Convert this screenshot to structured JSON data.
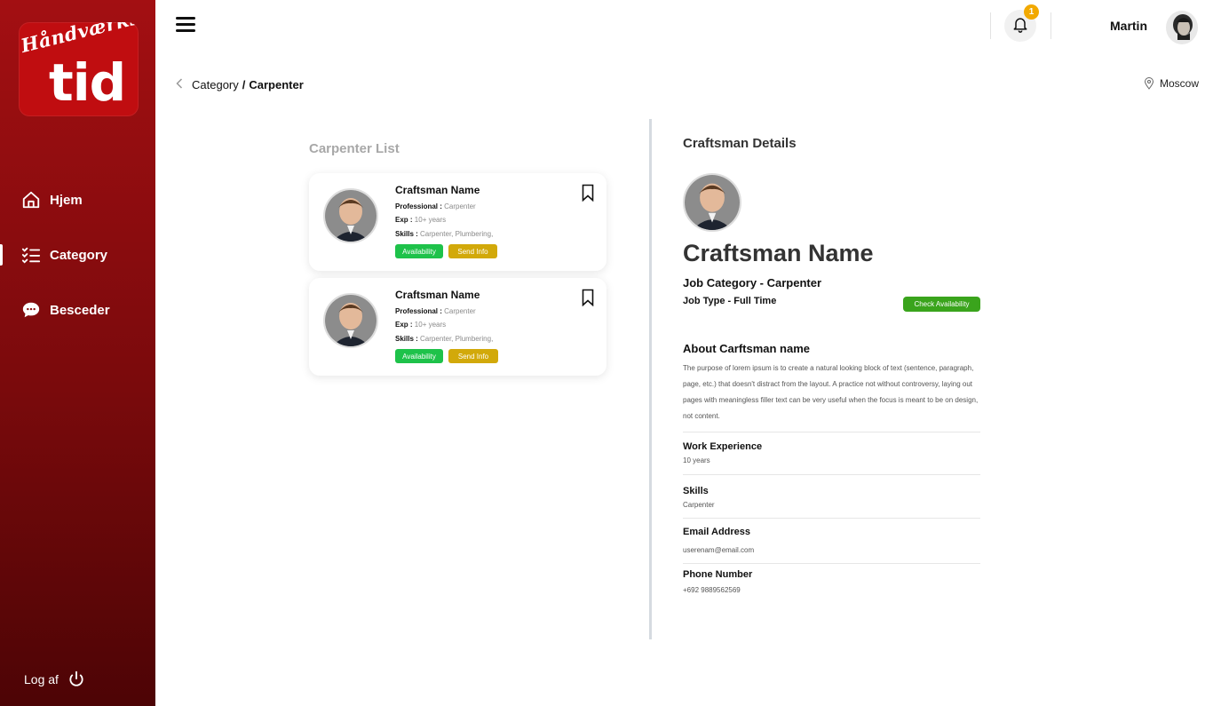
{
  "brand": {
    "script_text": "Håndværks",
    "big_text": "tid"
  },
  "sidebar": {
    "items": [
      {
        "label": "Hjem",
        "icon": "home-icon"
      },
      {
        "label": "Category",
        "icon": "checklist-icon",
        "active": true
      },
      {
        "label": "Besceder",
        "icon": "chat-icon"
      }
    ],
    "logout_label": "Log af"
  },
  "header": {
    "notification_count": "1",
    "user_name": "Martin"
  },
  "breadcrumb": {
    "parent": "Category",
    "separator": "/",
    "current": "Carpenter"
  },
  "location": "Moscow",
  "list": {
    "title": "Carpenter List",
    "cards": [
      {
        "name": "Craftsman Name",
        "professional_label": "Professional :",
        "professional": "Carpenter",
        "exp_label": "Exp :",
        "exp": "10+ years",
        "skills_label": "Skills :",
        "skills": "Carpenter, Plumbering,",
        "availability_label": "Availability",
        "send_info_label": "Send Info"
      },
      {
        "name": "Craftsman Name",
        "professional_label": "Professional :",
        "professional": "Carpenter",
        "exp_label": "Exp :",
        "exp": "10+ years",
        "skills_label": "Skills :",
        "skills": "Carpenter, Plumbering,",
        "availability_label": "Availability",
        "send_info_label": "Send Info"
      }
    ]
  },
  "details": {
    "section_title": "Craftsman Details",
    "name": "Craftsman Name",
    "job_category": "Job Category  - Carpenter",
    "job_type": "Job Type  - Full Time",
    "check_availability_label": "Check Availability",
    "about_title": "About Carftsman name",
    "about_text": "The purpose of lorem ipsum is to create a natural looking block of text (sentence, paragraph, page, etc.) that doesn't distract from the layout. A practice not without controversy, laying out pages with meaningless filler text can be very useful when the focus is meant to be on design, not content.",
    "fields": [
      {
        "label": "Work Experience",
        "value": "10 years"
      },
      {
        "label": "Skills",
        "value": "Carpenter"
      },
      {
        "label": "Email Address",
        "value": "userenam@email.com"
      },
      {
        "label": "Phone Number",
        "value": "+692 9889562569"
      }
    ]
  },
  "colors": {
    "sidebar": "#a30f12",
    "availability": "#1ec24a",
    "send_info": "#d2a90a",
    "check_availability": "#3aa41c",
    "badge": "#f2a900"
  }
}
